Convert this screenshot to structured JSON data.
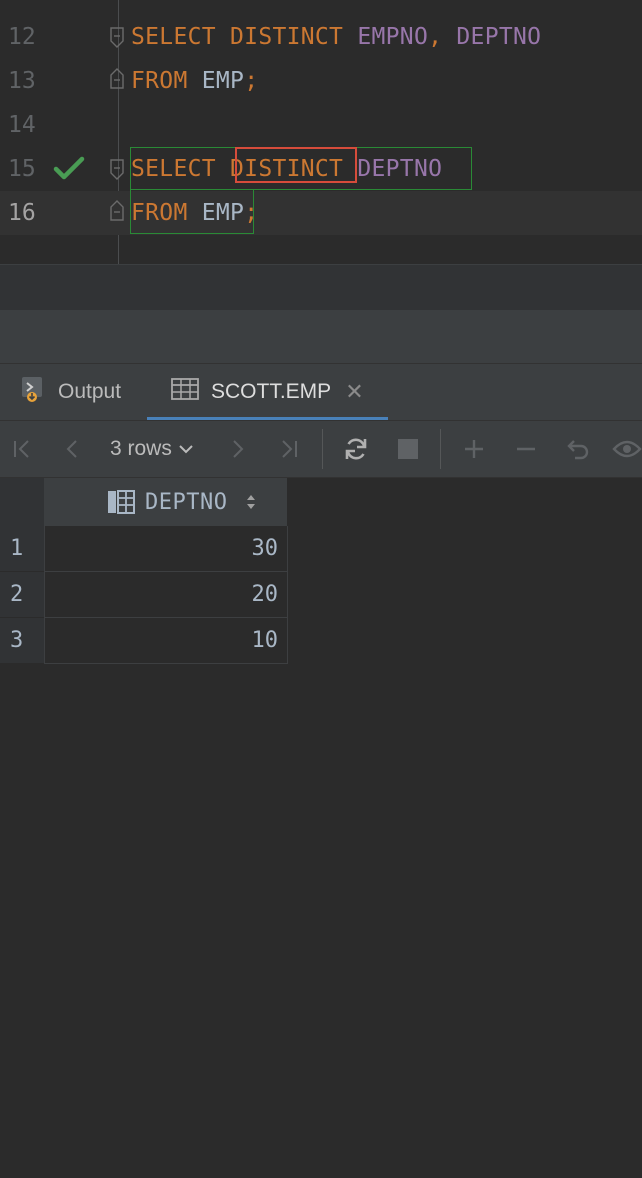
{
  "editor": {
    "lines": [
      {
        "number": "12",
        "tokens": [
          [
            "kw",
            "SELECT "
          ],
          [
            "kw",
            "DISTINCT "
          ],
          [
            "col",
            "EMPNO"
          ],
          [
            "pun",
            ", "
          ],
          [
            "col",
            "DEPTNO"
          ]
        ]
      },
      {
        "number": "13",
        "tokens": [
          [
            "kw",
            "FROM "
          ],
          [
            "id",
            "EMP"
          ],
          [
            "pun",
            ";"
          ]
        ]
      },
      {
        "number": "14",
        "tokens": []
      },
      {
        "number": "15",
        "tokens": [
          [
            "kw",
            "SELECT "
          ],
          [
            "kw",
            "DISTINCT "
          ],
          [
            "col",
            "DEPTNO"
          ]
        ]
      },
      {
        "number": "16",
        "tokens": [
          [
            "kw",
            "FROM "
          ],
          [
            "id",
            "EMP"
          ],
          [
            "pun",
            ";"
          ]
        ]
      }
    ],
    "current_line": "16",
    "executed_line": "15"
  },
  "tool_window": {
    "tabs": [
      {
        "label": "Output",
        "icon": "output-console-icon",
        "active": false
      },
      {
        "label": "SCOTT.EMP",
        "icon": "table-icon",
        "active": true
      }
    ],
    "close_glyph": "✕"
  },
  "toolbar": {
    "rows_label": "3 rows",
    "buttons": [
      "first-page-icon",
      "prev-page-icon",
      "next-page-icon",
      "last-page-icon",
      "refresh-icon",
      "stop-icon",
      "add-row-icon",
      "delete-row-icon",
      "revert-icon",
      "view-icon"
    ]
  },
  "grid": {
    "columns": [
      {
        "name": "DEPTNO",
        "icon": "column-icon",
        "sort": "none"
      }
    ],
    "rows": [
      {
        "n": "1",
        "values": [
          "30"
        ]
      },
      {
        "n": "2",
        "values": [
          "20"
        ]
      },
      {
        "n": "3",
        "values": [
          "10"
        ]
      }
    ]
  },
  "colors": {
    "keyword": "#cc7832",
    "column": "#9876aa",
    "identifier": "#a9b7c6",
    "success_check": "#499c54",
    "error_box": "#d64c3b",
    "statement_box": "#2a8a36"
  }
}
